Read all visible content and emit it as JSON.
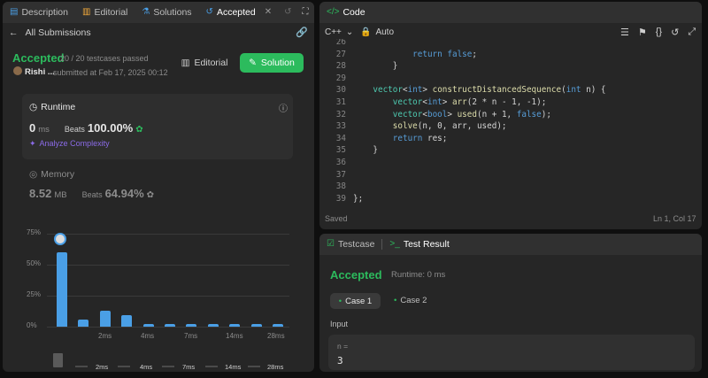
{
  "left_tabs": [
    {
      "label": "Description"
    },
    {
      "label": "Editorial"
    },
    {
      "label": "Solutions"
    },
    {
      "label": "Accepted"
    }
  ],
  "back_label": "All Submissions",
  "status": "Accepted",
  "testcases": "20 / 20 testcases passed",
  "user": "Rishi ...",
  "submitted": "submitted at Feb 17, 2025 00:12",
  "editorial_btn": "Editorial",
  "solution_btn": "Solution",
  "runtime": {
    "title": "Runtime",
    "value": "0",
    "unit": "ms",
    "beats_label": "Beats",
    "beats": "100.00%",
    "analyze": "Analyze Complexity"
  },
  "memory": {
    "title": "Memory",
    "value": "8.52",
    "unit": "MB",
    "beats_label": "Beats",
    "beats": "64.94%"
  },
  "chart_data": {
    "type": "bar",
    "y_ticks": [
      "75%",
      "50%",
      "25%",
      "0%"
    ],
    "ylim": [
      0,
      75
    ],
    "x_tick_labels": [
      "2ms",
      "4ms",
      "7ms",
      "14ms",
      "28ms"
    ],
    "values": [
      60,
      6,
      13,
      9,
      2,
      2,
      2,
      2,
      2,
      2,
      2
    ],
    "highlight_index": 0
  },
  "mini_chart": {
    "x_tick_labels": [
      "2ms",
      "4ms",
      "7ms",
      "14ms",
      "28ms"
    ]
  },
  "code_panel": {
    "title": "Code",
    "language": "C++",
    "auto": "Auto",
    "lines": [
      {
        "n": "26",
        "html": ""
      },
      {
        "n": "27",
        "html": "            <span class='kw'>return</span> <span class='kw'>false</span>;"
      },
      {
        "n": "28",
        "html": "        }"
      },
      {
        "n": "29",
        "html": ""
      },
      {
        "n": "30",
        "html": "    <span class='ty'>vector</span>&lt;<span class='kw'>int</span>&gt; <span class='fn'>constructDistancedSequence</span>(<span class='kw'>int</span> n) {"
      },
      {
        "n": "31",
        "html": "        <span class='ty'>vector</span>&lt;<span class='kw'>int</span>&gt; <span class='fn'>arr</span>(2 * n - 1, -1);"
      },
      {
        "n": "32",
        "html": "        <span class='ty'>vector</span>&lt;<span class='kw'>bool</span>&gt; <span class='fn'>used</span>(n + 1, <span class='kw'>false</span>);"
      },
      {
        "n": "33",
        "html": "        <span class='fn'>solve</span>(n, 0, arr, used);"
      },
      {
        "n": "34",
        "html": "        <span class='kw'>return</span> res;"
      },
      {
        "n": "35",
        "html": "    }"
      },
      {
        "n": "36",
        "html": ""
      },
      {
        "n": "37",
        "html": ""
      },
      {
        "n": "38",
        "html": ""
      },
      {
        "n": "39",
        "html": "};"
      }
    ],
    "saved": "Saved",
    "cursor": "Ln 1, Col 17"
  },
  "test_panel": {
    "tab_testcase": "Testcase",
    "tab_result": "Test Result",
    "status": "Accepted",
    "runtime": "Runtime: 0 ms",
    "case1": "Case 1",
    "case2": "Case 2",
    "input_label": "Input",
    "var_label": "n =",
    "var_value": "3"
  },
  "colors": {
    "accent_green": "#2cbb5d",
    "bar_blue": "#4a9fe6",
    "panel_bg": "#262626"
  }
}
